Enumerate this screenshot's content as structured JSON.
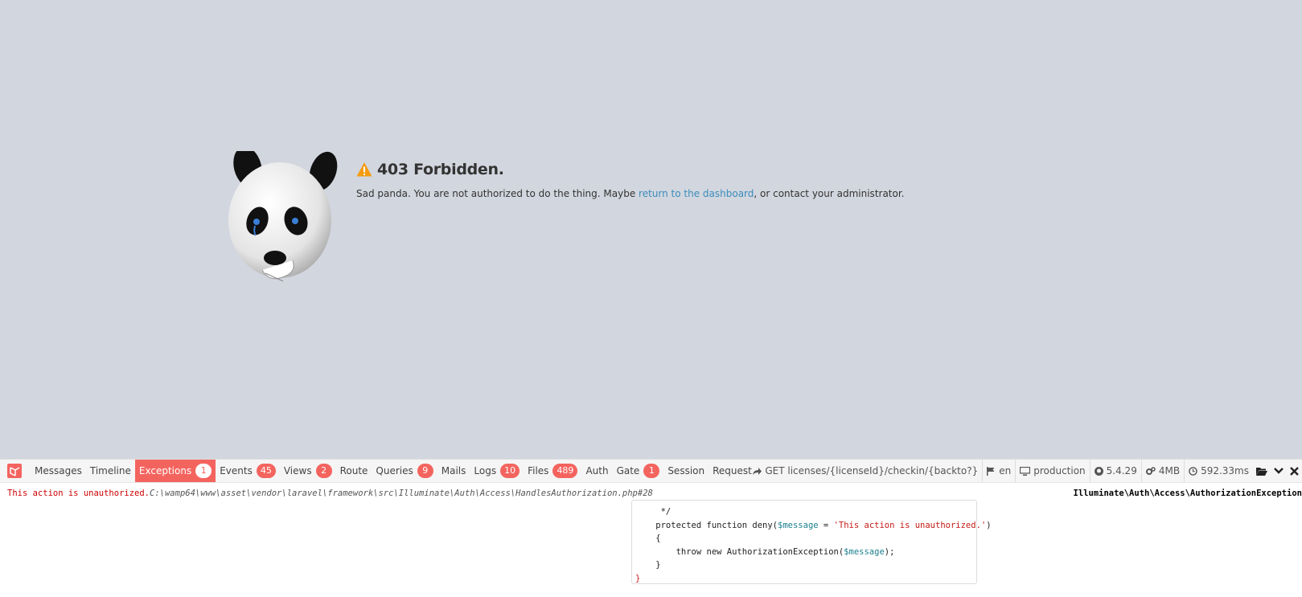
{
  "error": {
    "title": "403 Forbidden.",
    "message_prefix": "Sad panda. You are not authorized to do the thing. Maybe ",
    "link_text": "return to the dashboard",
    "message_suffix": ", or contact your administrator.",
    "link_color": "#3c8dbc"
  },
  "debugbar": {
    "tabs": [
      {
        "label": "Messages"
      },
      {
        "label": "Timeline"
      },
      {
        "label": "Exceptions",
        "badge": "1",
        "active": true
      },
      {
        "label": "Events",
        "badge": "45"
      },
      {
        "label": "Views",
        "badge": "2"
      },
      {
        "label": "Route"
      },
      {
        "label": "Queries",
        "badge": "9"
      },
      {
        "label": "Mails"
      },
      {
        "label": "Logs",
        "badge": "10"
      },
      {
        "label": "Files",
        "badge": "489"
      },
      {
        "label": "Auth"
      },
      {
        "label": "Gate",
        "badge": "1"
      },
      {
        "label": "Session"
      },
      {
        "label": "Request"
      }
    ],
    "indicators": {
      "route": "GET licenses/{licenseId}/checkin/{backto?}",
      "locale": "en",
      "environment": "production",
      "version": "5.4.29",
      "memory": "4MB",
      "time": "592.33ms"
    },
    "exception": {
      "message": "This action is unauthorized.",
      "file": "C:\\wamp64\\www\\asset\\vendor\\laravel\\framework\\src\\Illuminate\\Auth\\Access\\HandlesAuthorization.php#28",
      "class": "Illuminate\\Auth\\Access\\AuthorizationException",
      "code": {
        "l1": "     */",
        "l2a": "    protected function deny(",
        "l2b": "$message",
        "l2c": " = ",
        "l2d": "'This action is unauthorized.'",
        "l2e": ")",
        "l3": "    {",
        "l4a": "        throw new AuthorizationException(",
        "l4b": "$message",
        "l4c": ");",
        "l5": "    }",
        "l6": "}"
      }
    },
    "accent_color": "#f4645f"
  }
}
